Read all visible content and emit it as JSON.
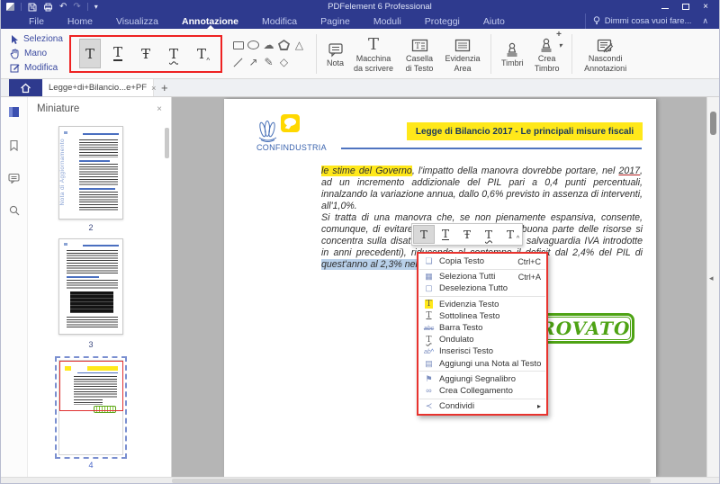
{
  "window": {
    "title": "PDFelement 6 Professional"
  },
  "menubar": {
    "items": [
      "File",
      "Home",
      "Visualizza",
      "Annotazione",
      "Modifica",
      "Pagine",
      "Moduli",
      "Proteggi",
      "Aiuto"
    ],
    "assistant": "Dimmi cosa vuoi fare..."
  },
  "ribbon": {
    "select": "Seleziona",
    "hand": "Mano",
    "edit": "Modifica",
    "nota": "Nota",
    "typewriter": "Macchina da scrivere",
    "textbox": "Casella di Testo",
    "area": "Evidenzia Area",
    "stamps": "Timbri",
    "create_stamp": "Crea Timbro",
    "hide_annotations": "Nascondi Annotazioni"
  },
  "tabs": {
    "doc_tab": "Legge+di+Bilancio...e+PF"
  },
  "panel": {
    "title": "Miniature",
    "vertical_text": "Nota di Aggiornamento",
    "page2": "2",
    "page3": "3",
    "page4": "4"
  },
  "doc": {
    "logo": "CONFINDUSTRIA",
    "title": "Legge di Bilancio 2017 -  Le principali misure fiscali",
    "p1_hl": "le stime del Governo",
    "p1_a": ", l'impatto della manovra dovrebbe portare, nel ",
    "p1_u": "2017",
    "p1_b": ", ad un incremento addizionale del PIL pari a 0,4 punti percentuali, innalzando la variazione annua, dallo 0,6% previsto in assenza di interventi, all'1,0%.",
    "p2_a": "Si tratta di una manovra che, se non pienamente espansiva, consente, comunque, di evitare contrazioni annunciate (buona parte delle risorse si concentra sulla disattivazione delle clausole di salvaguardia IVA introdotte in anni precedenti), riducendo al contempo il deficit dal 2,4% del PIL di ",
    "p2_sel": "quest'anno al 2,3% nel 2017.",
    "stamp": "APPROVATO"
  },
  "context_menu": {
    "items": [
      {
        "label": "Copia Testo",
        "shortcut": "Ctrl+C"
      },
      {
        "label": "Seleziona Tutti",
        "shortcut": "Ctrl+A"
      },
      {
        "label": "Deseleziona Tutto",
        "shortcut": ""
      },
      {
        "label": "Evidenzia Testo",
        "shortcut": ""
      },
      {
        "label": "Sottolinea Testo",
        "shortcut": ""
      },
      {
        "label": "Barra Testo",
        "shortcut": ""
      },
      {
        "label": "Ondulato",
        "shortcut": ""
      },
      {
        "label": "Inserisci Testo",
        "shortcut": ""
      },
      {
        "label": "Aggiungi una Nota al Testo",
        "shortcut": ""
      },
      {
        "label": "Aggiungi Segnalibro",
        "shortcut": ""
      },
      {
        "label": "Crea Collegamento",
        "shortcut": ""
      },
      {
        "label": "Condividi",
        "shortcut": ""
      }
    ]
  },
  "icons": {
    "close": "×",
    "plus": "+",
    "collapse_ribbon": "∧",
    "undo": "↶",
    "redo": "↷",
    "dropdown": "▾",
    "submenu_arrow": "▸",
    "panel_collapse": "◂",
    "cloud": "☁",
    "triangle": "△",
    "arrow": "↗",
    "pencil": "✎",
    "diamond": "◇",
    "T": "T",
    "T_stroke": "Ŧ",
    "caret": "^",
    "abc": "abc",
    "ab": "ab",
    "copy": "❏",
    "select_all": "▦",
    "deselect": "▢",
    "note": "▤",
    "bookmark": "⚑",
    "link": "∞",
    "share": "≺"
  },
  "colors": {
    "accent_navy": "#2e3a8e",
    "highlight_yellow": "#ffe81a",
    "stamp_green": "#4ea314",
    "selection_blue": "#b8d0ea",
    "marker_red": "#ee2222"
  }
}
